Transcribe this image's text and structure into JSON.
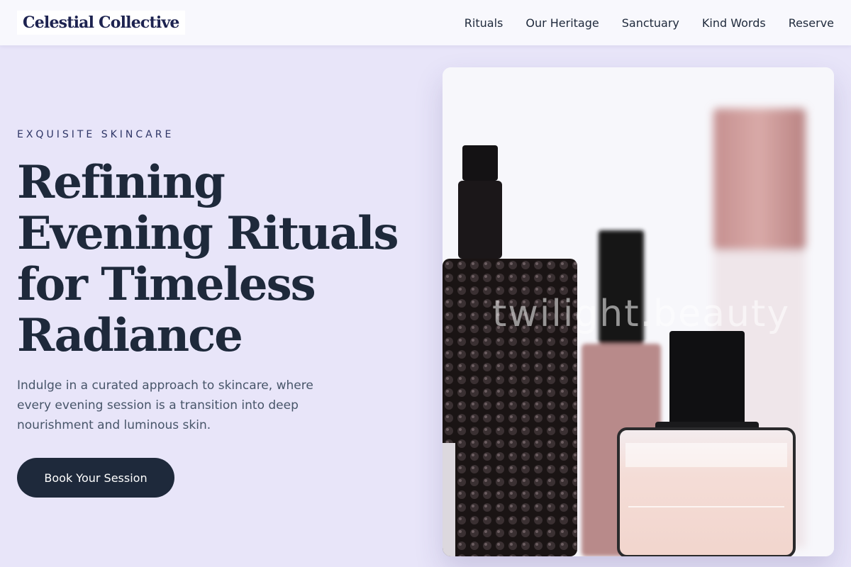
{
  "brand": {
    "name": "Celestial Collective"
  },
  "nav": {
    "items": [
      "Rituals",
      "Our Heritage",
      "Sanctuary",
      "Kind Words",
      "Reserve"
    ]
  },
  "hero": {
    "eyebrow": "EXQUISITE SKINCARE",
    "headline": "Refining Evening Rituals for Timeless Radiance",
    "body": "Indulge in a curated approach to skincare, where every evening session is a transition into deep nourishment and luminous skin.",
    "cta_label": "Book Your Session"
  },
  "image": {
    "watermark": "twilight.beauty",
    "subject": "perfume-bottles-photo"
  },
  "colors": {
    "background": "#e8e5f9",
    "header": "#f8f8fd",
    "text": "#1e293b",
    "brand": "#1d2350",
    "button": "#1e293b",
    "button_text": "#ffffff"
  }
}
